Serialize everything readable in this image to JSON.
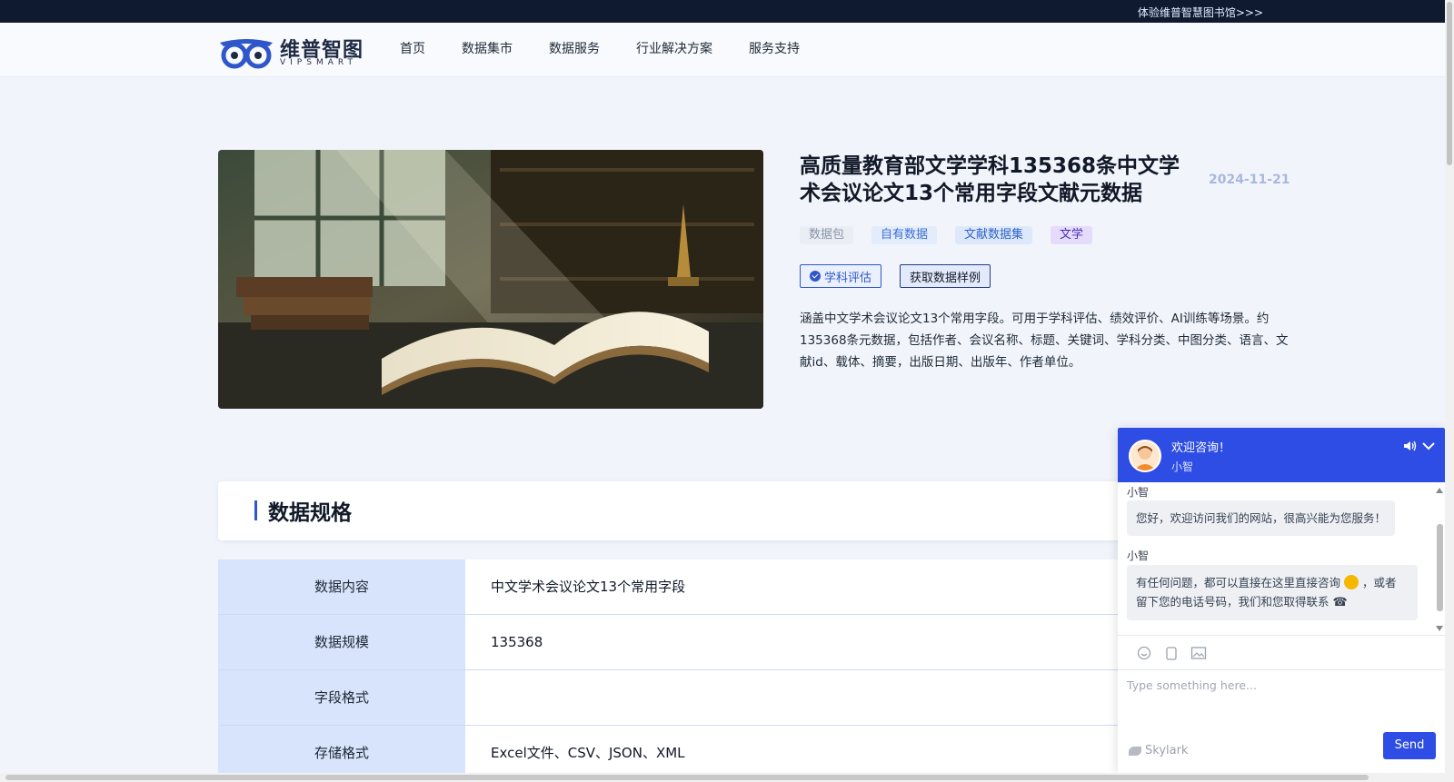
{
  "topbar": {
    "link_text": "体验维普智慧图书馆>>>"
  },
  "brand": {
    "name": "维普智图",
    "sub": "VIPSMART"
  },
  "nav": {
    "items": [
      "首页",
      "数据集市",
      "数据服务",
      "行业解决方案",
      "服务支持"
    ]
  },
  "dataset": {
    "title": "高质量教育部文学学科135368条中文学术会议论文13个常用字段文献元数据",
    "date": "2024-11-21",
    "tags": [
      "数据包",
      "自有数据",
      "文献数据集",
      "文学"
    ],
    "action_eval": "学科评估",
    "action_sample": "获取数据样例",
    "description": "涵盖中文学术会议论文13个常用字段。可用于学科评估、绩效评价、AI训练等场景。约135368条元数据，包括作者、会议名称、标题、关键词、学科分类、中图分类、语言、文献id、载体、摘要，出版日期、出版年、作者单位。"
  },
  "spec": {
    "heading": "数据规格",
    "rows": [
      {
        "key": "数据内容",
        "value": "中文学术会议论文13个常用字段"
      },
      {
        "key": "数据规模",
        "value": "135368"
      },
      {
        "key": "字段格式",
        "value": ""
      },
      {
        "key": "存储格式",
        "value": "Excel文件、CSV、JSON、XML"
      }
    ]
  },
  "chat": {
    "title": "欢迎咨询！",
    "agent": "小智",
    "messages": [
      {
        "sender": "小智",
        "text": "您好，欢迎访问我们的网站，很高兴能为您服务！"
      },
      {
        "sender": "小智",
        "text_line1": "有任何问题，都可以直接在这里直接咨询",
        "text_line1b": "，或者",
        "text_line2": "留下您的电话号码，我们和您取得联系"
      }
    ],
    "input_placeholder": "Type something here...",
    "brand": "Skylark",
    "send_label": "Send",
    "accent": "#2e4de4"
  },
  "icons": [
    "owl-logo-icon",
    "check-circle-icon",
    "speaker-icon",
    "chevron-down-icon",
    "emoji-icon",
    "attach-icon",
    "image-icon",
    "bird-icon",
    "phone-icon",
    "smiley-icon"
  ]
}
